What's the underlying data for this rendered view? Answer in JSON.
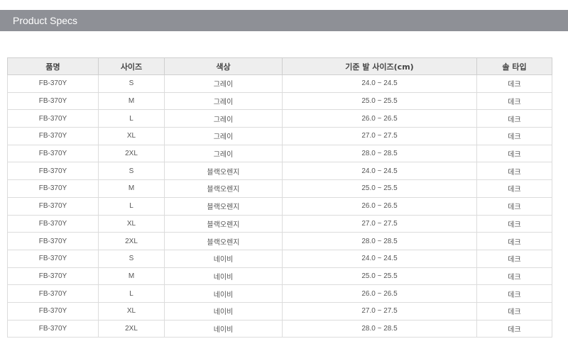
{
  "header": {
    "title": "Product Specs"
  },
  "table": {
    "columns": [
      "품명",
      "사이즈",
      "색상",
      "기준 발 사이즈(cm)",
      "솔 타입"
    ],
    "rows": [
      [
        "FB-370Y",
        "S",
        "그레이",
        "24.0 ~ 24.5",
        "데크"
      ],
      [
        "FB-370Y",
        "M",
        "그레이",
        "25.0 ~ 25.5",
        "데크"
      ],
      [
        "FB-370Y",
        "L",
        "그레이",
        "26.0 ~ 26.5",
        "데크"
      ],
      [
        "FB-370Y",
        "XL",
        "그레이",
        "27.0 ~ 27.5",
        "데크"
      ],
      [
        "FB-370Y",
        "2XL",
        "그레이",
        "28.0 ~ 28.5",
        "데크"
      ],
      [
        "FB-370Y",
        "S",
        "블랙오렌지",
        "24.0 ~ 24.5",
        "데크"
      ],
      [
        "FB-370Y",
        "M",
        "블랙오렌지",
        "25.0 ~ 25.5",
        "데크"
      ],
      [
        "FB-370Y",
        "L",
        "블랙오렌지",
        "26.0 ~ 26.5",
        "데크"
      ],
      [
        "FB-370Y",
        "XL",
        "블랙오렌지",
        "27.0 ~ 27.5",
        "데크"
      ],
      [
        "FB-370Y",
        "2XL",
        "블랙오렌지",
        "28.0 ~ 28.5",
        "데크"
      ],
      [
        "FB-370Y",
        "S",
        "네이비",
        "24.0 ~ 24.5",
        "데크"
      ],
      [
        "FB-370Y",
        "M",
        "네이비",
        "25.0 ~ 25.5",
        "데크"
      ],
      [
        "FB-370Y",
        "L",
        "네이비",
        "26.0 ~ 26.5",
        "데크"
      ],
      [
        "FB-370Y",
        "XL",
        "네이비",
        "27.0 ~ 27.5",
        "데크"
      ],
      [
        "FB-370Y",
        "2XL",
        "네이비",
        "28.0 ~ 28.5",
        "데크"
      ]
    ]
  },
  "colors": {
    "header_bar": "#8e9096",
    "table_header_bg": "#eeeeee",
    "border": "#dcdcdc"
  }
}
